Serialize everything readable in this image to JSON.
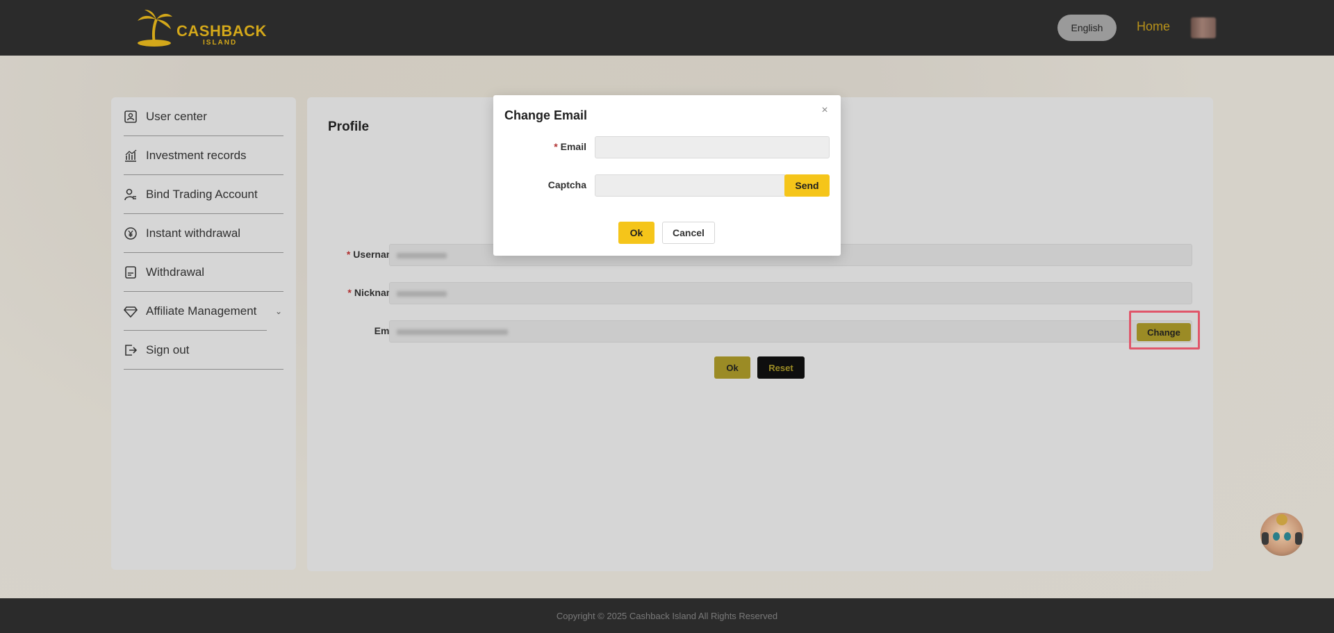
{
  "header": {
    "logo_text": "CASHBACK",
    "logo_subtext": "ISLAND",
    "language_label": "English",
    "home_label": "Home"
  },
  "sidebar": {
    "items": [
      {
        "label": "User center",
        "icon": "user-card-icon"
      },
      {
        "label": "Investment records",
        "icon": "chart-icon"
      },
      {
        "label": "Bind Trading Account",
        "icon": "user-link-icon"
      },
      {
        "label": "Instant withdrawal",
        "icon": "currency-icon"
      },
      {
        "label": "Withdrawal",
        "icon": "document-icon"
      },
      {
        "label": "Affiliate Management",
        "icon": "diamond-hand-icon",
        "has_submenu": true
      },
      {
        "label": "Sign out",
        "icon": "sign-out-icon"
      }
    ]
  },
  "profile": {
    "title": "Profile",
    "fields": [
      {
        "label": "Username",
        "required": true
      },
      {
        "label": "Nickname",
        "required": true
      },
      {
        "label": "Email",
        "required": false
      }
    ],
    "required_mark": "*",
    "change_label": "Change",
    "ok_label": "Ok",
    "reset_label": "Reset"
  },
  "dialog": {
    "title": "Change Email",
    "close_icon": "×",
    "email_label": "Email",
    "email_value": "",
    "captcha_label": "Captcha",
    "captcha_value": "",
    "send_label": "Send",
    "ok_label": "Ok",
    "cancel_label": "Cancel"
  },
  "footer": {
    "copyright": "Copyright © 2025 Cashback Island All Rights Reserved"
  },
  "colors": {
    "accent_yellow": "#f5c51a",
    "header_bg": "#2b2b2b",
    "highlight": "#e0566a"
  }
}
